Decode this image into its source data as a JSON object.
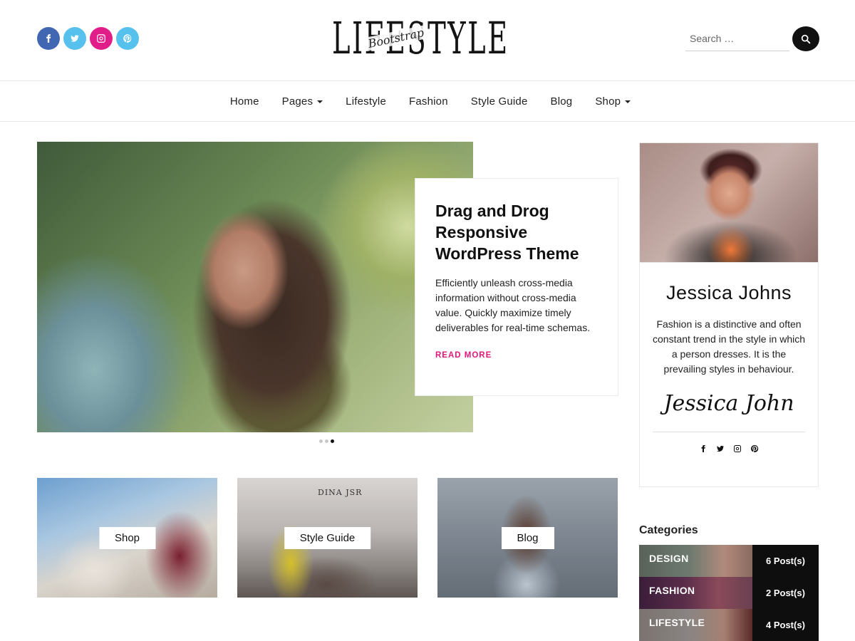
{
  "header": {
    "logo_main": "LIFESTYLE",
    "logo_sub": "Bootstrap",
    "search_placeholder": "Search …",
    "socials": [
      {
        "icon": "facebook-icon",
        "color": "#4267B2"
      },
      {
        "icon": "twitter-icon",
        "color": "#56C1EC"
      },
      {
        "icon": "instagram-icon",
        "color": "#E11D8A"
      },
      {
        "icon": "pinterest-icon",
        "color": "#56C1EC"
      }
    ]
  },
  "nav": {
    "items": [
      {
        "label": "Home",
        "dropdown": false
      },
      {
        "label": "Pages",
        "dropdown": true
      },
      {
        "label": "Lifestyle",
        "dropdown": false
      },
      {
        "label": "Fashion",
        "dropdown": false
      },
      {
        "label": "Style Guide",
        "dropdown": false
      },
      {
        "label": "Blog",
        "dropdown": false
      },
      {
        "label": "Shop",
        "dropdown": true
      }
    ]
  },
  "hero": {
    "title": "Drag and Drog Responsive WordPress Theme",
    "text": "Efficiently unleash cross-media information without cross-media value. Quickly maximize timely deliverables for real-time schemas.",
    "read_more": "READ MORE",
    "slide_count": 3,
    "active_slide": 3
  },
  "tiles": [
    {
      "label": "Shop"
    },
    {
      "label": "Style Guide",
      "brand": "DINA JSR"
    },
    {
      "label": "Blog"
    }
  ],
  "profile": {
    "name": "Jessica Johns",
    "bio": "Fashion is a distinctive and often constant trend in the style in which a person dresses. It is the prevailing styles in behaviour.",
    "signature": "Jessica John",
    "socials": [
      "facebook-icon",
      "twitter-icon",
      "instagram-icon",
      "pinterest-icon"
    ]
  },
  "categories": {
    "heading": "Categories",
    "items": [
      {
        "name": "DESIGN",
        "count": "6 Post(s)"
      },
      {
        "name": "FASHION",
        "count": "2 Post(s)"
      },
      {
        "name": "LIFESTYLE",
        "count": "4 Post(s)"
      }
    ]
  },
  "colors": {
    "accent": "#E3177D",
    "dark": "#111111"
  }
}
